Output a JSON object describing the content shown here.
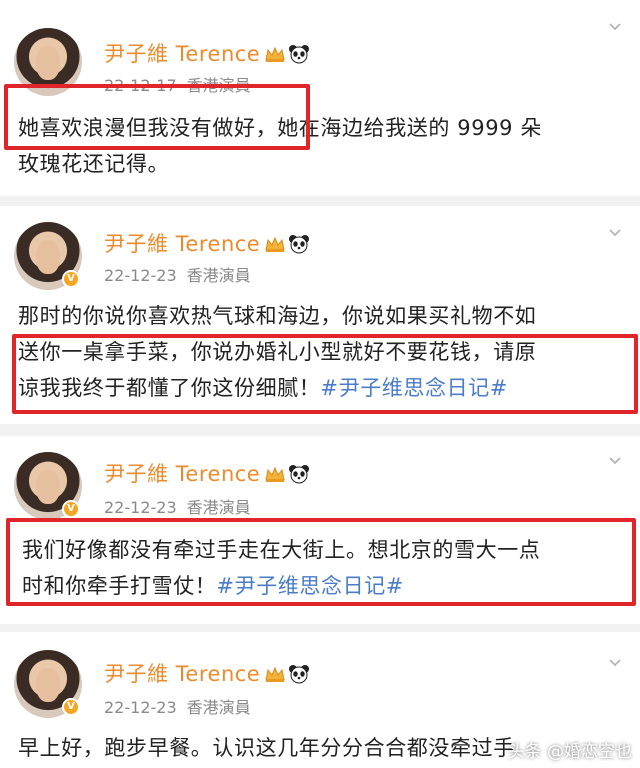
{
  "posts": [
    {
      "author": "尹子維 Terence",
      "date": "22-12-17",
      "source": "香港演員",
      "text_lines": [
        "她喜欢浪漫但我没有做好，她在海边给我送的 9999 朵",
        "玫瑰花还记得。"
      ],
      "hashtag": ""
    },
    {
      "author": "尹子維 Terence",
      "date": "22-12-23",
      "source": "香港演員",
      "text_lines": [
        "那时的你说你喜欢热气球和海边，你说如果买礼物不如",
        "送你一桌拿手菜，你说办婚礼小型就好不要花钱，请原",
        "谅我我终于都懂了你这份细腻！"
      ],
      "hashtag": "#尹子维思念日记#"
    },
    {
      "author": "尹子維 Terence",
      "date": "22-12-23",
      "source": "香港演員",
      "text_lines": [
        "我们好像都没有牵过手走在大街上。想北京的雪大一点",
        "时和你牵手打雪仗！"
      ],
      "hashtag": "#尹子维思念日记#"
    },
    {
      "author": "尹子維 Terence",
      "date": "22-12-23",
      "source": "香港演員",
      "text_lines": [
        "早上好，跑步早餐。认识这几年分分合合都没牵过手"
      ],
      "hashtag": ""
    }
  ],
  "watermark": "头条 @婚恋空也",
  "icons": {
    "verified_badge": "verified-v-icon",
    "crown": "crown-icon",
    "panda": "panda-icon",
    "chevron": "chevron-down-icon"
  },
  "colors": {
    "username": "#ea8c2e",
    "hashtag": "#4a7cc9",
    "highlight_box": "#e0262b",
    "meta": "#8a8a8a"
  }
}
